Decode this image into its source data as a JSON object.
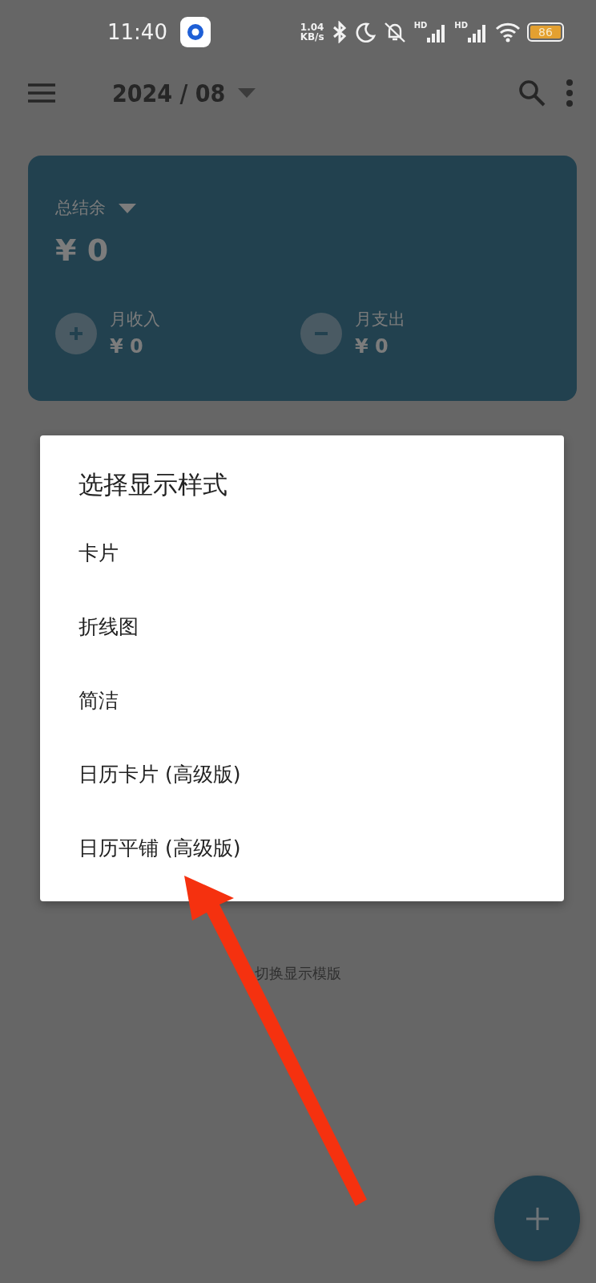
{
  "status_bar": {
    "time": "11:40",
    "net_speed": "1.04",
    "net_unit": "KB/s",
    "signal_labels": [
      "HD",
      "HD"
    ],
    "battery": "86"
  },
  "toolbar": {
    "month": "2024 / 08"
  },
  "summary": {
    "label": "总结余",
    "total": "¥ 0",
    "income": {
      "label": "月收入",
      "amount": "¥ 0"
    },
    "expense": {
      "label": "月支出",
      "amount": "¥ 0"
    }
  },
  "dialog": {
    "title": "选择显示样式",
    "options": [
      {
        "label": "卡片"
      },
      {
        "label": "折线图"
      },
      {
        "label": "简洁"
      },
      {
        "label": "日历卡片 (高级版)"
      },
      {
        "label": "日历平铺 (高级版)"
      }
    ]
  },
  "hint": "切换显示模版"
}
